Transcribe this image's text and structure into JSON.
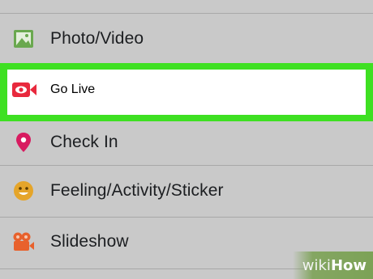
{
  "menu": {
    "items": [
      {
        "label": "Photo/Video",
        "icon": "photo-icon",
        "icon_color": "#6aa84f"
      },
      {
        "label": "Go Live",
        "icon": "live-camera-icon",
        "icon_color": "#e8293d"
      },
      {
        "label": "Check In",
        "icon": "location-pin-icon",
        "icon_color": "#d81b60"
      },
      {
        "label": "Feeling/Activity/Sticker",
        "icon": "smiley-icon",
        "icon_color": "#e5a52a"
      },
      {
        "label": "Slideshow",
        "icon": "film-camera-icon",
        "icon_color": "#e8612c"
      }
    ]
  },
  "highlight": {
    "color": "#3ee022"
  },
  "watermark": {
    "prefix": "wiki",
    "suffix": "How"
  }
}
